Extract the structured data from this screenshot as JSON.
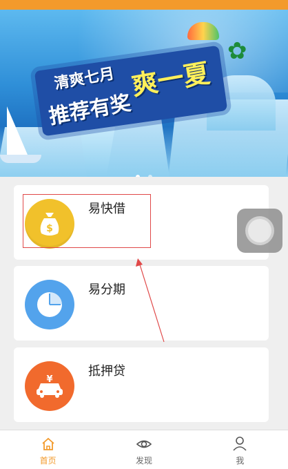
{
  "banner": {
    "line1": "清爽七月",
    "line2": "推荐有奖",
    "line3": "爽一夏"
  },
  "products": [
    {
      "label": "易快借",
      "icon": "money-bag-icon",
      "color": "#f1c12b"
    },
    {
      "label": "易分期",
      "icon": "pie-chart-icon",
      "color": "#53a3ec"
    },
    {
      "label": "抵押贷",
      "icon": "car-icon",
      "color": "#f16a2d"
    }
  ],
  "tabs": [
    {
      "label": "首页",
      "icon": "home-icon",
      "active": true
    },
    {
      "label": "发现",
      "icon": "eye-icon",
      "active": false
    },
    {
      "label": "我",
      "icon": "user-icon",
      "active": false
    }
  ],
  "colors": {
    "accent": "#f39a2b",
    "highlight_box": "#e04848"
  }
}
